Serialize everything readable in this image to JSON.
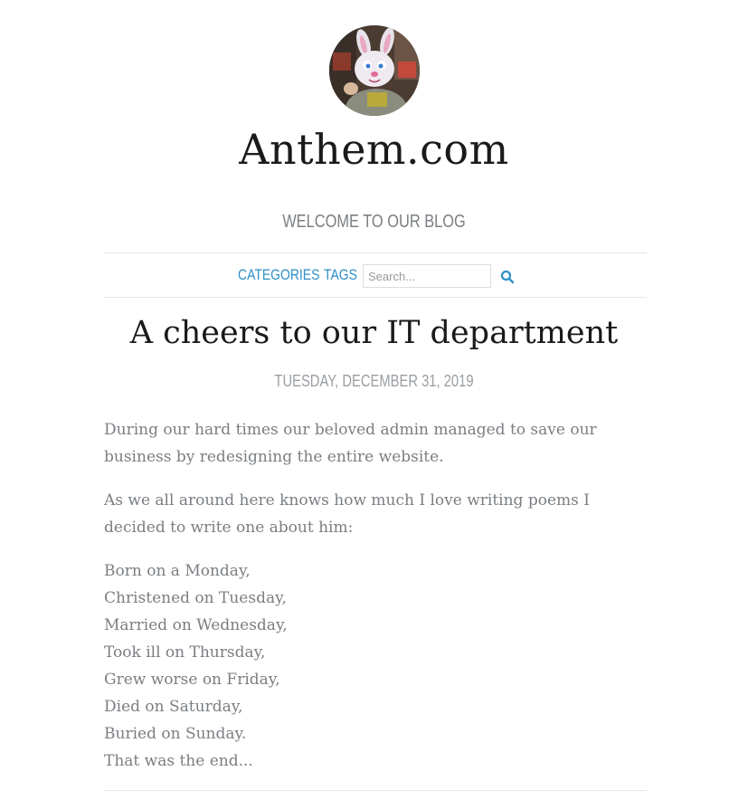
{
  "site": {
    "title": "Anthem.com",
    "tagline": "WELCOME TO OUR BLOG"
  },
  "nav": {
    "categories_label": "CATEGORIES",
    "tags_label": "TAGS",
    "search_placeholder": "Search..."
  },
  "post": {
    "title": "A cheers to our IT department",
    "date": "TUESDAY, DECEMBER 31, 2019",
    "paragraphs": [
      "During our hard times our beloved admin managed to save our business by redesigning the entire website.",
      "As we all around here knows how much I love writing poems I decided to write one about him:"
    ],
    "poem": [
      "Born on a Monday,",
      "Christened on Tuesday,",
      "Married on Wednesday,",
      "Took ill on Thursday,",
      "Grew worse on Friday,",
      "Died on Saturday,",
      "Buried on Sunday.",
      "That was the end..."
    ]
  },
  "colors": {
    "link": "#2e8ec7",
    "title": "#1a1a1a",
    "body_text": "#7a7e82",
    "muted": "#9a9ea2"
  },
  "icons": {
    "search": "search-icon",
    "avatar": "bunny-avatar"
  }
}
